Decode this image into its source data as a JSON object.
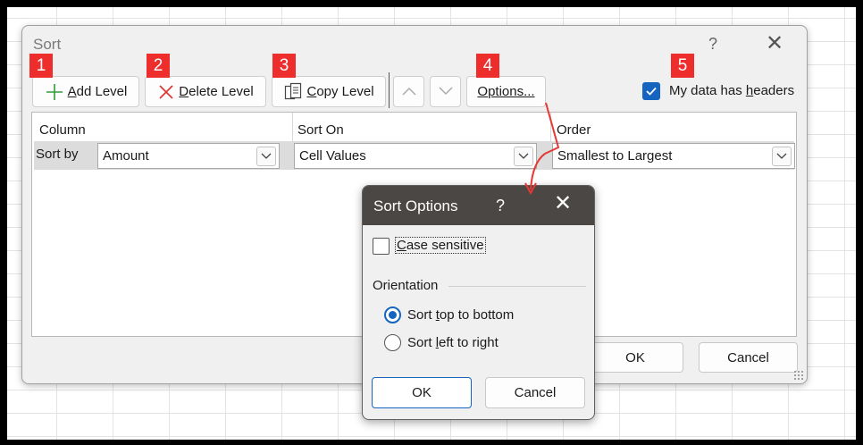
{
  "sort_dialog": {
    "title": "Sort",
    "help": "?",
    "close": "✕",
    "toolbar": {
      "add_level": {
        "pre": "",
        "key": "A",
        "rest": "dd Level"
      },
      "delete_level": {
        "pre": "",
        "key": "D",
        "rest": "elete Level"
      },
      "copy_level": {
        "pre": "",
        "key": "C",
        "rest": "opy Level"
      },
      "options": {
        "key": "O",
        "rest": "ptions..."
      }
    },
    "headers_checkbox": {
      "label_pre": "My data has ",
      "label_key": "h",
      "label_rest": "eaders",
      "checked": true
    },
    "columns": [
      "Column",
      "Sort On",
      "Order"
    ],
    "row": {
      "label": "Sort by",
      "column_value": "Amount",
      "sort_on_value": "Cell Values",
      "order_value": "Smallest to Largest"
    },
    "ok": "OK",
    "cancel": "Cancel"
  },
  "badges": [
    "1",
    "2",
    "3",
    "4",
    "5"
  ],
  "sort_options": {
    "title": "Sort Options",
    "help": "?",
    "close": "✕",
    "case_sensitive": {
      "key": "C",
      "rest": "ase sensitive",
      "checked": false
    },
    "orientation_label": "Orientation",
    "radio_top": {
      "pre": "Sort ",
      "key": "t",
      "rest": "op to bottom",
      "selected": true
    },
    "radio_left": {
      "pre": "Sort ",
      "key": "l",
      "rest": "eft to right",
      "selected": false
    },
    "ok": "OK",
    "cancel": "Cancel"
  },
  "colors": {
    "accent": "#1565c0",
    "badge": "#ee2d2d",
    "arrow": "#e53935",
    "titlebar": "#4a4744"
  }
}
